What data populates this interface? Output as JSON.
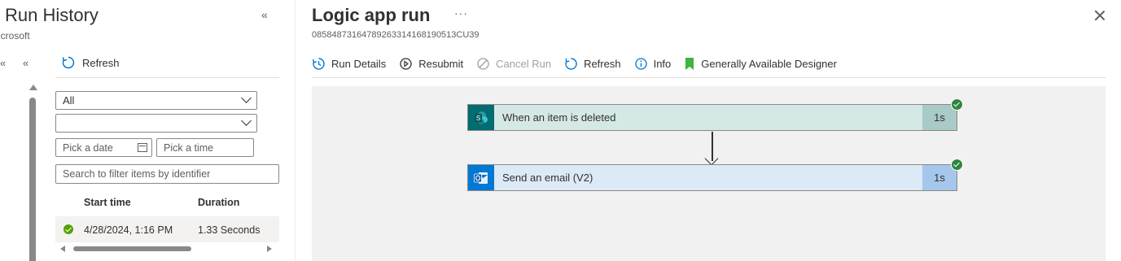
{
  "left_panel": {
    "title": "Run History",
    "subtitle": "icrosoft",
    "collapse_icon": "double-chevron-left",
    "nav_arrows": [
      "«",
      "«"
    ],
    "refresh_label": "Refresh",
    "status_filter": {
      "value": "All"
    },
    "second_filter": {
      "value": ""
    },
    "date_placeholder": "Pick a date",
    "time_placeholder": "Pick a time",
    "search_placeholder": "Search to filter items by identifier",
    "columns": {
      "start": "Start time",
      "duration": "Duration"
    },
    "runs": [
      {
        "status": "succeeded",
        "start_time": "4/28/2024, 1:16 PM",
        "duration": "1.33 Seconds"
      }
    ]
  },
  "right_panel": {
    "title": "Logic app run",
    "more": "···",
    "run_id": "08584873164789263314168190513CU39",
    "toolbar": {
      "run_details": "Run Details",
      "resubmit": "Resubmit",
      "cancel_run": "Cancel Run",
      "refresh": "Refresh",
      "info": "Info",
      "designer": "Generally Available Designer"
    },
    "steps": [
      {
        "label": "When an item is deleted",
        "duration": "1s",
        "icon": "sharepoint-icon",
        "status": "succeeded",
        "colors": {
          "body": "#d4e8e6",
          "icon_bg": "#036c70",
          "dur_bg": "#a9cac7"
        }
      },
      {
        "label": "Send an email (V2)",
        "duration": "1s",
        "icon": "outlook-icon",
        "status": "succeeded",
        "colors": {
          "body": "#dce9f6",
          "icon_bg": "#0078d4",
          "dur_bg": "#a6c7ec"
        }
      }
    ]
  },
  "colors": {
    "accent": "#0078d4",
    "success": "#2e8540",
    "run_success": "#57a300",
    "designer_flag": "#3fb43f"
  }
}
